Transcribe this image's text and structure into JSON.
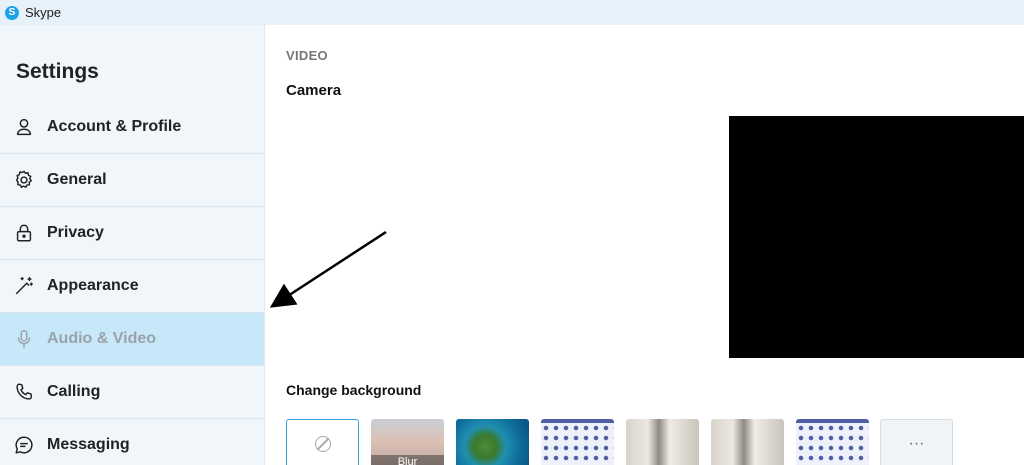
{
  "window": {
    "app_title": "Skype"
  },
  "sidebar": {
    "title": "Settings",
    "items": [
      {
        "label": "Account & Profile",
        "icon": "person-icon",
        "active": false
      },
      {
        "label": "General",
        "icon": "gear-icon",
        "active": false
      },
      {
        "label": "Privacy",
        "icon": "lock-icon",
        "active": false
      },
      {
        "label": "Appearance",
        "icon": "magic-wand-icon",
        "active": false
      },
      {
        "label": "Audio & Video",
        "icon": "microphone-icon",
        "active": true
      },
      {
        "label": "Calling",
        "icon": "phone-icon",
        "active": false
      },
      {
        "label": "Messaging",
        "icon": "chat-bubble-icon",
        "active": false
      }
    ]
  },
  "main": {
    "section": "VIDEO",
    "camera_label": "Camera",
    "change_background_label": "Change background",
    "backgrounds": [
      {
        "type": "none",
        "icon": "no-background-icon"
      },
      {
        "type": "blur",
        "label": "Blur"
      },
      {
        "type": "image",
        "theme": "island"
      },
      {
        "type": "image",
        "theme": "pattern"
      },
      {
        "type": "image",
        "theme": "room"
      },
      {
        "type": "image",
        "theme": "room"
      },
      {
        "type": "image",
        "theme": "pattern"
      },
      {
        "type": "more",
        "label": "···"
      }
    ]
  },
  "colors": {
    "titlebar_bg": "#e7f1fa",
    "sidebar_bg": "#f1f6fb",
    "active_item_bg": "#c7e8f8",
    "skype_blue": "#1fa3e8",
    "camera_preview": "#000000"
  }
}
